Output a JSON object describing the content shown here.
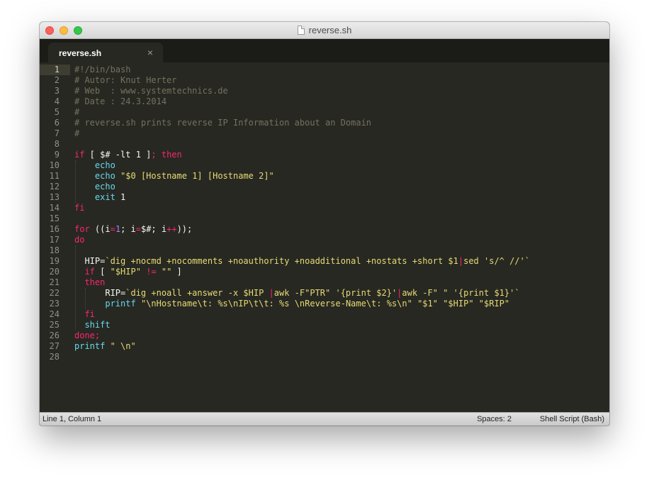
{
  "window": {
    "title": "reverse.sh"
  },
  "tabs": [
    {
      "label": "reverse.sh",
      "close_glyph": "×",
      "active": true
    }
  ],
  "editor": {
    "current_line": 1,
    "lines": [
      [
        [
          "comment",
          "#!/bin/bash"
        ]
      ],
      [
        [
          "comment",
          "# Autor: Knut Herter"
        ]
      ],
      [
        [
          "comment",
          "# Web  : www.systemtechnics.de"
        ]
      ],
      [
        [
          "comment",
          "# Date : 24.3.2014"
        ]
      ],
      [
        [
          "comment",
          "#"
        ]
      ],
      [
        [
          "comment",
          "# reverse.sh prints reverse IP Information about an Domain"
        ]
      ],
      [
        [
          "comment",
          "#"
        ]
      ],
      [],
      [
        [
          "keyword",
          "if"
        ],
        [
          "plain",
          " [ $# -lt 1 ]"
        ],
        [
          "keyword",
          ";"
        ],
        [
          "plain",
          " "
        ],
        [
          "keyword",
          "then"
        ]
      ],
      [
        [
          "plain",
          "    "
        ],
        [
          "builtin",
          "echo"
        ]
      ],
      [
        [
          "plain",
          "    "
        ],
        [
          "builtin",
          "echo"
        ],
        [
          "plain",
          " "
        ],
        [
          "string",
          "\"$0 [Hostname 1] [Hostname 2]\""
        ]
      ],
      [
        [
          "plain",
          "    "
        ],
        [
          "builtin",
          "echo"
        ]
      ],
      [
        [
          "plain",
          "    "
        ],
        [
          "builtin",
          "exit"
        ],
        [
          "plain",
          " 1"
        ]
      ],
      [
        [
          "keyword",
          "fi"
        ]
      ],
      [],
      [
        [
          "keyword",
          "for"
        ],
        [
          "plain",
          " ((i"
        ],
        [
          "keyword",
          "="
        ],
        [
          "number",
          "1"
        ],
        [
          "plain",
          "; i"
        ],
        [
          "keyword",
          "="
        ],
        [
          "plain",
          "$#; i"
        ],
        [
          "keyword",
          "++"
        ],
        [
          "plain",
          "));"
        ]
      ],
      [
        [
          "keyword",
          "do"
        ]
      ],
      [],
      [
        [
          "plain",
          "  HIP="
        ],
        [
          "string",
          "`dig +nocmd +nocomments +noauthority +noadditional +nostats +short $1"
        ],
        [
          "keyword",
          "|"
        ],
        [
          "string",
          "sed 's/^ //'`"
        ]
      ],
      [
        [
          "plain",
          "  "
        ],
        [
          "keyword",
          "if"
        ],
        [
          "plain",
          " [ "
        ],
        [
          "string",
          "\"$HIP\""
        ],
        [
          "plain",
          " "
        ],
        [
          "keyword",
          "!="
        ],
        [
          "plain",
          " "
        ],
        [
          "string",
          "\"\""
        ],
        [
          "plain",
          " ]"
        ]
      ],
      [
        [
          "plain",
          "  "
        ],
        [
          "keyword",
          "then"
        ]
      ],
      [
        [
          "plain",
          "      RIP="
        ],
        [
          "string",
          "`dig +noall +answer -x $HIP "
        ],
        [
          "keyword",
          "|"
        ],
        [
          "string",
          "awk -F\"PTR\" '{print $2}'"
        ],
        [
          "keyword",
          "|"
        ],
        [
          "string",
          "awk -F\" \" '{print $1}'`"
        ]
      ],
      [
        [
          "plain",
          "      "
        ],
        [
          "builtin",
          "printf"
        ],
        [
          "plain",
          " "
        ],
        [
          "string",
          "\"\\nHostname\\t: %s\\nIP\\t\\t: %s \\nReverse-Name\\t: %s\\n\" \"$1\" \"$HIP\" \"$RIP\""
        ]
      ],
      [
        [
          "plain",
          "  "
        ],
        [
          "keyword",
          "fi"
        ]
      ],
      [
        [
          "plain",
          "  "
        ],
        [
          "builtin",
          "shift"
        ]
      ],
      [
        [
          "keyword",
          "done;"
        ]
      ],
      [
        [
          "builtin",
          "printf"
        ],
        [
          "plain",
          " "
        ],
        [
          "string",
          "\" \\n\""
        ]
      ],
      []
    ]
  },
  "status": {
    "position": "Line 1, Column 1",
    "spaces": "Spaces: 2",
    "syntax": "Shell Script (Bash)"
  },
  "colors": {
    "background": "#272822",
    "comment": "#75715e",
    "keyword": "#f92672",
    "builtin": "#66d9ef",
    "string": "#e6db74",
    "number": "#ae81ff",
    "plain": "#f8f8f2"
  }
}
